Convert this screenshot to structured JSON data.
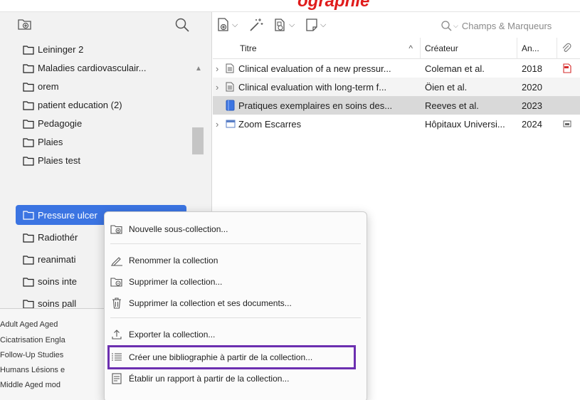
{
  "banner": {
    "cut_text": "ographie"
  },
  "left_pane": {
    "search_icon": "search-icon",
    "new_collection_icon": "new-collection-icon",
    "collections": [
      {
        "label": "Leininger 2"
      },
      {
        "label": "Maladies cardiovasculair..."
      },
      {
        "label": "orem"
      },
      {
        "label": "patient education (2)"
      },
      {
        "label": "Pedagogie"
      },
      {
        "label": "Plaies"
      },
      {
        "label": "Plaies test"
      },
      {
        "label": "Pressure ulcer",
        "selected": true
      },
      {
        "label": "Radiothér"
      },
      {
        "label": "reanimati"
      },
      {
        "label": "soins inte"
      },
      {
        "label": "soins pall"
      }
    ],
    "tags": [
      "Adult  Aged  Aged",
      "Cicatrisation  Engla",
      "Follow-Up Studies",
      "Humans  Lésions e",
      "Middle Aged  mod"
    ]
  },
  "toolbar": {
    "search_placeholder": "Champs & Marqueurs"
  },
  "columns": {
    "title": "Titre",
    "creator": "Créateur",
    "year": "An..."
  },
  "items": [
    {
      "title": "Clinical evaluation of a new pressur...",
      "creator": "Coleman et al.",
      "year": "2018",
      "expander": "›",
      "type_icon": "document-icon",
      "attachment_icon": "pdf-icon"
    },
    {
      "title": "Clinical evaluation with long-term f...",
      "creator": "Öien et al.",
      "year": "2020",
      "expander": "›",
      "type_icon": "document-icon",
      "attachment_icon": ""
    },
    {
      "title": "Pratiques exemplaires en soins des...",
      "creator": "Reeves et al.",
      "year": "2023",
      "expander": "",
      "type_icon": "book-icon",
      "attachment_icon": ""
    },
    {
      "title": "Zoom Escarres",
      "creator": "Hôpitaux Universi...",
      "year": "2024",
      "expander": "›",
      "type_icon": "webpage-icon",
      "attachment_icon": "snapshot-icon"
    }
  ],
  "context_menu": {
    "items": [
      {
        "label": "Nouvelle sous-collection...",
        "icon": "new-subcollection-icon"
      },
      {
        "label": "Renommer la collection",
        "icon": "rename-icon"
      },
      {
        "label": "Supprimer la collection...",
        "icon": "delete-collection-icon"
      },
      {
        "label": "Supprimer la collection et ses documents...",
        "icon": "trash-icon"
      },
      {
        "label": "Exporter la collection...",
        "icon": "export-icon"
      },
      {
        "label": "Créer une bibliographie à partir de la collection...",
        "icon": "bibliography-icon",
        "highlighted": true
      },
      {
        "label": "Établir un rapport à partir de la collection...",
        "icon": "report-icon"
      }
    ]
  },
  "colors": {
    "selection": "#3b74e2",
    "highlight_box": "#6c2fb0",
    "pdf_red": "#d62b2b",
    "banner_red": "#e01b1b"
  }
}
